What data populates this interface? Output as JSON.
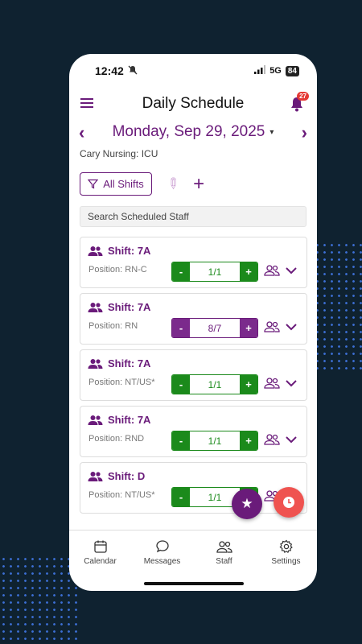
{
  "status_bar": {
    "time": "12:42",
    "network": "5G",
    "battery": "84"
  },
  "header": {
    "title": "Daily Schedule",
    "notification_count": "27"
  },
  "date_nav": {
    "date": "Monday, Sep 29, 2025",
    "caret": "▾"
  },
  "unit": "Cary Nursing: ICU",
  "toolbar": {
    "filter_label": "All Shifts"
  },
  "search": {
    "placeholder": "Search Scheduled Staff"
  },
  "shifts": [
    {
      "shift": "Shift: 7A",
      "position": "Position: RN-C",
      "count": "1/1",
      "status": "green"
    },
    {
      "shift": "Shift: 7A",
      "position": "Position: RN",
      "count": "8/7",
      "status": "purple"
    },
    {
      "shift": "Shift: 7A",
      "position": "Position: NT/US*",
      "count": "1/1",
      "status": "green"
    },
    {
      "shift": "Shift: 7A",
      "position": "Position: RND",
      "count": "1/1",
      "status": "green"
    },
    {
      "shift": "Shift: D",
      "position": "Position: NT/US*",
      "count": "1/1",
      "status": "green"
    }
  ],
  "stepper_labels": {
    "minus": "-",
    "plus": "+"
  },
  "tabs": [
    {
      "label": "Calendar",
      "icon": "calendar-icon"
    },
    {
      "label": "Messages",
      "icon": "chat-icon"
    },
    {
      "label": "Staff",
      "icon": "people-icon"
    },
    {
      "label": "Settings",
      "icon": "gear-icon"
    }
  ],
  "colors": {
    "brand": "#6a1b7a",
    "ok": "#1b8a1b",
    "alert": "#ef5350",
    "background": "#0f2230"
  }
}
